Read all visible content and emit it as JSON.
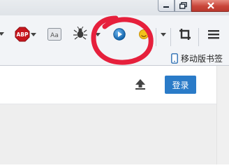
{
  "window": {
    "controls": {
      "minimize_icon": "minimize-icon",
      "maximize_icon": "maximize-icon",
      "close_icon": "close-icon"
    }
  },
  "toolbar": {
    "abp_label": "ABP",
    "reader_label": "Aa",
    "icons": [
      "abp-icon",
      "reader-icon",
      "bug-icon",
      "play-icon",
      "emoji-icon",
      "crop-icon",
      "menu-icon"
    ]
  },
  "bookmarks": {
    "mobile_label": "移动版书签"
  },
  "page": {
    "login_label": "登录",
    "upload_icon": "upload-icon"
  },
  "colors": {
    "accent_blue": "#2a7bc8",
    "annotation_red": "#e6203c",
    "close_red": "#c9463a"
  }
}
